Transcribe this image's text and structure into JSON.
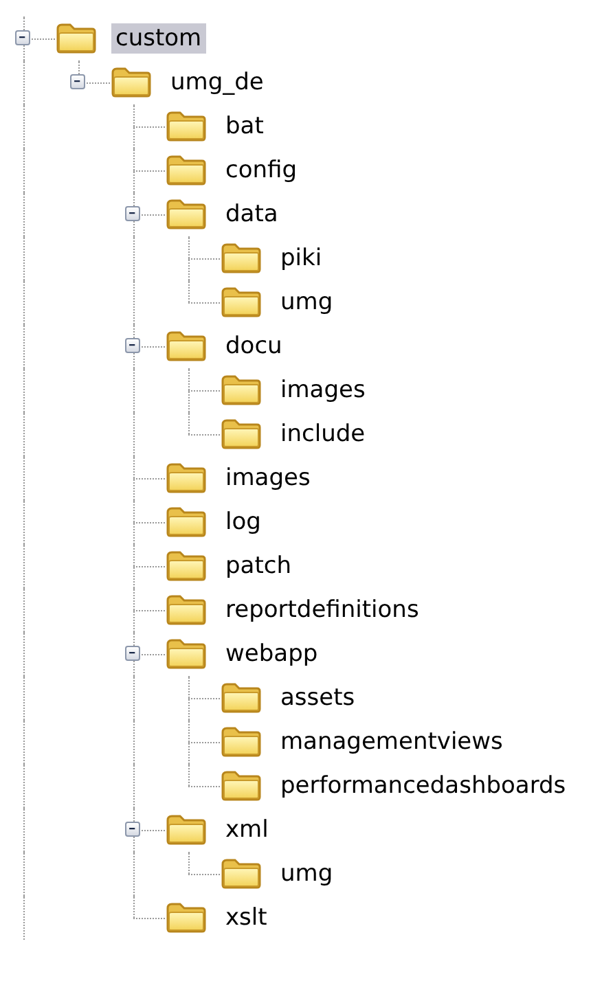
{
  "tree": [
    {
      "label": "custom",
      "selected": true,
      "expanded": true,
      "children": [
        {
          "label": "umg_de",
          "selected": false,
          "expanded": true,
          "children": [
            {
              "label": "bat",
              "selected": false
            },
            {
              "label": "config",
              "selected": false
            },
            {
              "label": "data",
              "selected": false,
              "expanded": true,
              "children": [
                {
                  "label": "piki",
                  "selected": false
                },
                {
                  "label": "umg",
                  "selected": false
                }
              ]
            },
            {
              "label": "docu",
              "selected": false,
              "expanded": true,
              "children": [
                {
                  "label": "images",
                  "selected": false
                },
                {
                  "label": "include",
                  "selected": false
                }
              ]
            },
            {
              "label": "images",
              "selected": false
            },
            {
              "label": "log",
              "selected": false
            },
            {
              "label": "patch",
              "selected": false
            },
            {
              "label": "reportdefinitions",
              "selected": false
            },
            {
              "label": "webapp",
              "selected": false,
              "expanded": true,
              "children": [
                {
                  "label": "assets",
                  "selected": false
                },
                {
                  "label": "managementviews",
                  "selected": false
                },
                {
                  "label": "performancedashboards",
                  "selected": false
                }
              ]
            },
            {
              "label": "xml",
              "selected": false,
              "expanded": true,
              "children": [
                {
                  "label": "umg",
                  "selected": false
                }
              ]
            },
            {
              "label": "xslt",
              "selected": false
            }
          ]
        }
      ]
    }
  ]
}
